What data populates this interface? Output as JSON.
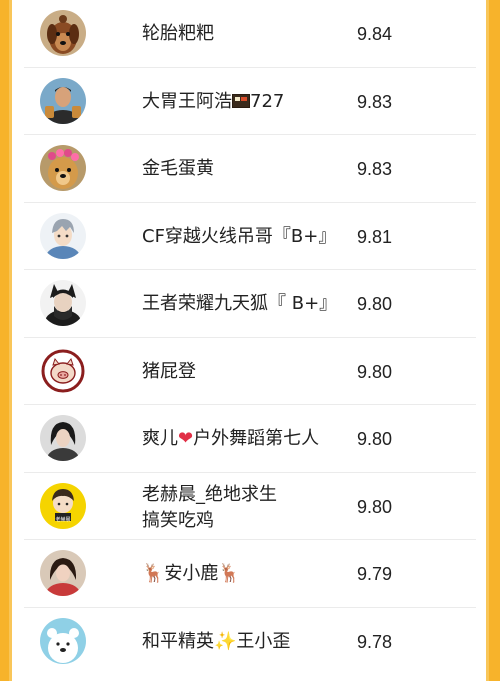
{
  "rows": [
    {
      "name_parts": [
        "轮胎粑粑"
      ],
      "score": "9.84",
      "avatar_icon": "dog-avatar"
    },
    {
      "name_parts": [
        "大胃王阿浩",
        "727"
      ],
      "score": "9.83",
      "avatar_icon": "man-food-avatar",
      "inline_icon": "bento-icon"
    },
    {
      "name_parts": [
        "金毛蛋黄"
      ],
      "score": "9.83",
      "avatar_icon": "golden-retriever-avatar"
    },
    {
      "name_parts": [
        "CF穿越火线吊哥『B+』"
      ],
      "score": "9.81",
      "avatar_icon": "anime-boy-avatar"
    },
    {
      "name_parts": [
        "王者荣耀九天狐『 B+』"
      ],
      "score": "9.80",
      "avatar_icon": "fox-character-avatar"
    },
    {
      "name_parts": [
        "猪屁登"
      ],
      "score": "9.80",
      "avatar_icon": "pig-logo-avatar"
    },
    {
      "name_parts": [
        "爽儿",
        "户外舞蹈第七人"
      ],
      "score": "9.80",
      "avatar_icon": "woman-avatar",
      "inline_icon": "heart-icon"
    },
    {
      "name_parts": [
        "老赫晨_绝地求生",
        "搞笑吃鸡"
      ],
      "score": "9.80",
      "avatar_icon": "cartoon-boy-avatar",
      "avatar_caption": "老赫晨"
    },
    {
      "name_parts": [
        "安小鹿"
      ],
      "score": "9.79",
      "avatar_icon": "girl-avatar",
      "inline_icon": "deer-icon"
    },
    {
      "name_parts": [
        "和平精英",
        "王小歪"
      ],
      "score": "9.78",
      "avatar_icon": "bear-avatar",
      "inline_icon": "sparkle-icon"
    }
  ],
  "colors": {
    "frame": "#f7b32b",
    "divider": "#ebebeb",
    "text": "#222222"
  }
}
